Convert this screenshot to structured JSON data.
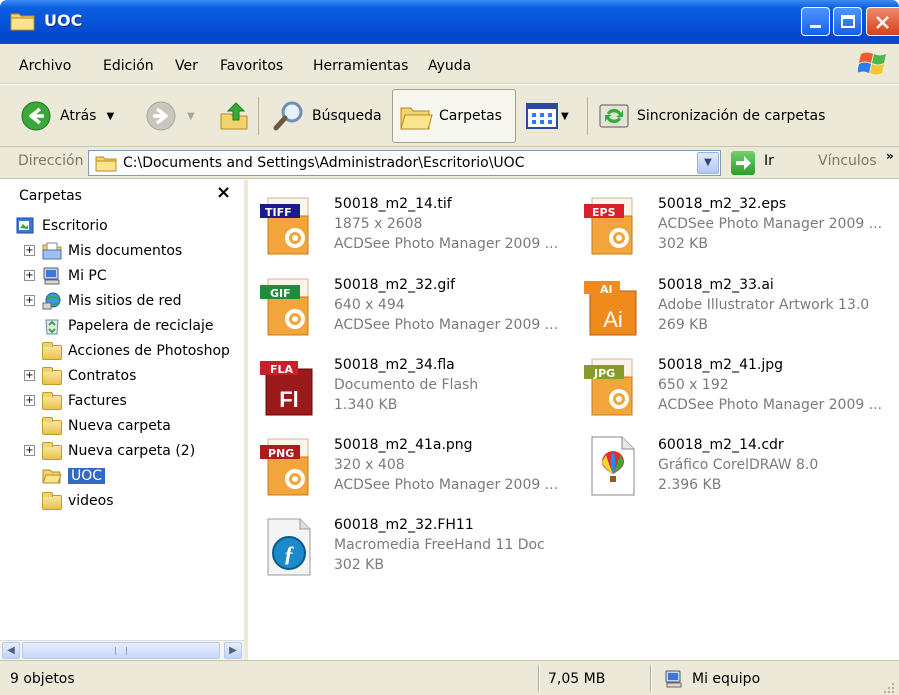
{
  "window": {
    "title": "UOC"
  },
  "menu": {
    "items": [
      {
        "label": "Archivo"
      },
      {
        "label": "Edición"
      },
      {
        "label": "Ver"
      },
      {
        "label": "Favoritos"
      },
      {
        "label": "Herramientas"
      },
      {
        "label": "Ayuda"
      }
    ]
  },
  "toolbar": {
    "back_label": "Atrás",
    "search_label": "Búsqueda",
    "folders_label": "Carpetas",
    "sync_label": "Sincronización de carpetas"
  },
  "address": {
    "label": "Dirección",
    "path": "C:\\Documents and Settings\\Administrador\\Escritorio\\UOC",
    "go_label": "Ir",
    "links_label": "Vínculos"
  },
  "folder_pane": {
    "title": "Carpetas",
    "items": [
      {
        "label": "Escritorio"
      },
      {
        "label": "Mis documentos"
      },
      {
        "label": "Mi PC"
      },
      {
        "label": "Mis sitios de red"
      },
      {
        "label": "Papelera de reciclaje"
      },
      {
        "label": "Acciones de Photoshop"
      },
      {
        "label": "Contratos"
      },
      {
        "label": "Factures"
      },
      {
        "label": "Nueva carpeta"
      },
      {
        "label": "Nueva carpeta (2)"
      },
      {
        "label": "UOC"
      },
      {
        "label": "videos"
      }
    ]
  },
  "files": [
    {
      "name": "50018_m2_14.tif",
      "line2": "1875 x 2608",
      "line3": "ACDSee Photo Manager 2009 ...",
      "badge": "TIFF",
      "badge_color": "#1a1a8c",
      "icon": "acdsee-icon"
    },
    {
      "name": "50018_m2_32.eps",
      "line2": "ACDSee Photo Manager 2009 ...",
      "line3": "302 KB",
      "badge": "EPS",
      "badge_color": "#d8202a",
      "icon": "acdsee-icon"
    },
    {
      "name": "50018_m2_32.gif",
      "line2": "640 x 494",
      "line3": "ACDSee Photo Manager 2009 ...",
      "badge": "GIF",
      "badge_color": "#1e8c3a",
      "icon": "acdsee-icon"
    },
    {
      "name": "50018_m2_33.ai",
      "line2": "Adobe Illustrator Artwork 13.0",
      "line3": "269 KB",
      "badge": "AI",
      "badge_color": "#f08a1a",
      "icon": "illustrator-icon"
    },
    {
      "name": "50018_m2_34.fla",
      "line2": "Documento de Flash",
      "line3": "1.340 KB",
      "badge": "FLA",
      "badge_color": "#c8202a",
      "icon": "flash-icon"
    },
    {
      "name": "50018_m2_41.jpg",
      "line2": "650 x 192",
      "line3": "ACDSee Photo Manager 2009 ...",
      "badge": "JPG",
      "badge_color": "#8a9a2a",
      "icon": "acdsee-icon"
    },
    {
      "name": "50018_m2_41a.png",
      "line2": "320 x 408",
      "line3": "ACDSee Photo Manager 2009 ...",
      "badge": "PNG",
      "badge_color": "#b01a1a",
      "icon": "acdsee-icon"
    },
    {
      "name": "60018_m2_14.cdr",
      "line2": "Gráfico CorelDRAW 8.0",
      "line3": "2.396 KB",
      "badge": "",
      "badge_color": "",
      "icon": "coreldraw-icon"
    },
    {
      "name": "60018_m2_32.FH11",
      "line2": "Macromedia FreeHand 11 Doc",
      "line3": "302 KB",
      "badge": "",
      "badge_color": "",
      "icon": "freehand-icon"
    }
  ],
  "status": {
    "count": "9 objetos",
    "size": "7,05 MB",
    "location": "Mi equipo"
  }
}
